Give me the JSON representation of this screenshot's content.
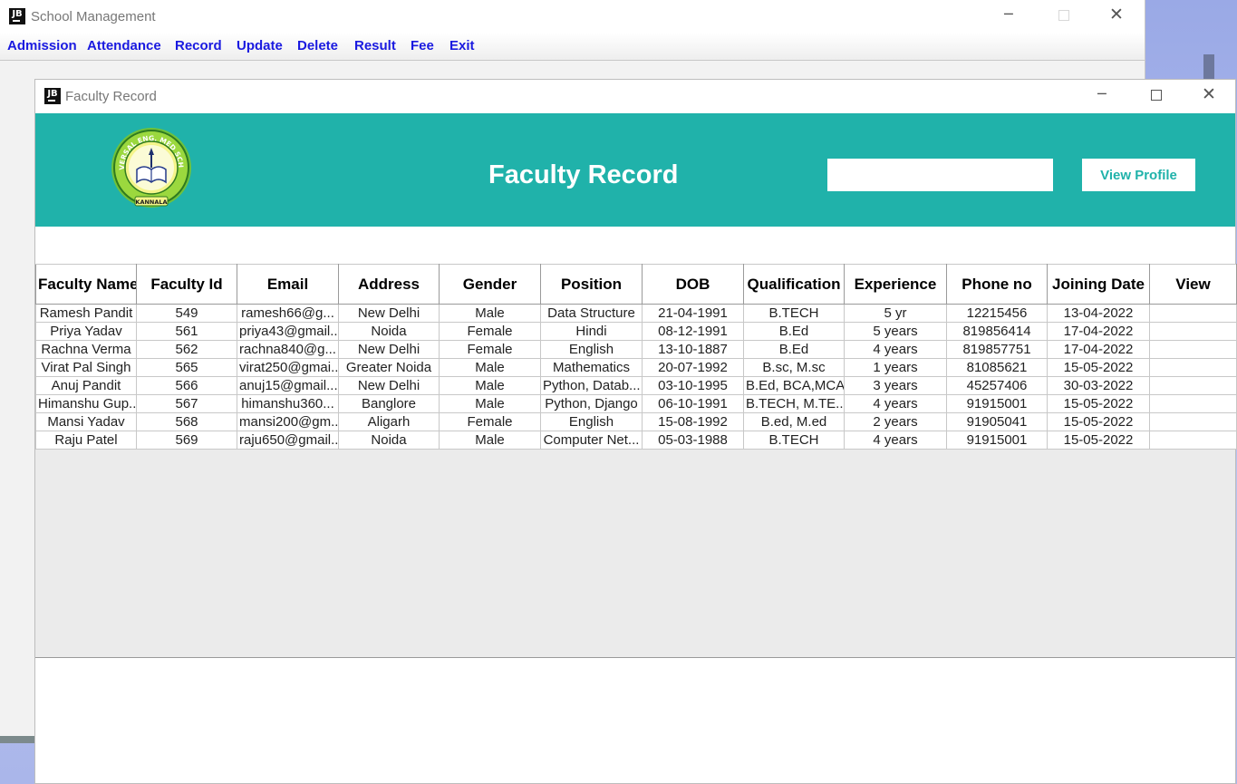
{
  "main_window": {
    "title": "School Management",
    "menu": [
      "Admission",
      "Attendance",
      "Record",
      "Update",
      "Delete",
      "Result",
      "Fee",
      "Exit"
    ]
  },
  "window_controls": {
    "minimize": "─",
    "maximize": "",
    "close": "✕"
  },
  "app_icon_text": "JB",
  "faculty_window": {
    "title": "Faculty Record",
    "heading": "Faculty Record",
    "search_value": "",
    "view_profile_label": "View Profile",
    "logo": {
      "top_text": "UNIVERSAL ENG. MED SCHOOL",
      "motto": "KNOWLEDGE IS POWER",
      "bottom_text": "KANNALA"
    }
  },
  "colors": {
    "header_band": "#20b2aa",
    "menu_text": "#1a1ae0",
    "button_text": "#20b2aa"
  },
  "table": {
    "columns": [
      "Faculty Name",
      "Faculty Id",
      "Email",
      "Address",
      "Gender",
      "Position",
      "DOB",
      "Qualification",
      "Experience",
      "Phone no",
      "Joining Date",
      "View"
    ],
    "rows": [
      [
        "Ramesh Pandit",
        "549",
        "ramesh66@g...",
        "New Delhi",
        "Male",
        "Data Structure",
        "21-04-1991",
        "B.TECH",
        "5 yr",
        "12215456",
        "13-04-2022",
        ""
      ],
      [
        "Priya Yadav",
        "561",
        "priya43@gmail...",
        "Noida",
        "Female",
        "Hindi",
        "08-12-1991",
        "B.Ed",
        "5 years",
        "819856414",
        "17-04-2022",
        ""
      ],
      [
        "Rachna Verma",
        "562",
        "rachna840@g...",
        "New Delhi",
        "Female",
        "English",
        "13-10-1887",
        "B.Ed",
        "4 years",
        "819857751",
        "17-04-2022",
        ""
      ],
      [
        "Virat Pal Singh",
        "565",
        "virat250@gmai...",
        "Greater Noida",
        "Male",
        "Mathematics",
        "20-07-1992",
        "B.sc, M.sc",
        "1 years",
        "81085621",
        "15-05-2022",
        ""
      ],
      [
        "Anuj Pandit",
        "566",
        "anuj15@gmail....",
        "New Delhi",
        "Male",
        "Python, Datab...",
        "03-10-1995",
        "B.Ed, BCA,MCA",
        "3 years",
        "45257406",
        "30-03-2022",
        ""
      ],
      [
        "Himanshu Gup...",
        "567",
        "himanshu360...",
        "Banglore",
        "Male",
        "Python, Django",
        "06-10-1991",
        "B.TECH, M.TE...",
        "4 years",
        "91915001",
        "15-05-2022",
        ""
      ],
      [
        "Mansi Yadav",
        "568",
        "mansi200@gm...",
        "Aligarh",
        "Female",
        "English",
        "15-08-1992",
        "B.ed, M.ed",
        "2 years",
        "91905041",
        "15-05-2022",
        ""
      ],
      [
        "Raju Patel",
        "569",
        "raju650@gmail...",
        "Noida",
        "Male",
        "Computer Net...",
        "05-03-1988",
        "B.TECH",
        "4 years",
        "91915001",
        "15-05-2022",
        ""
      ]
    ]
  }
}
